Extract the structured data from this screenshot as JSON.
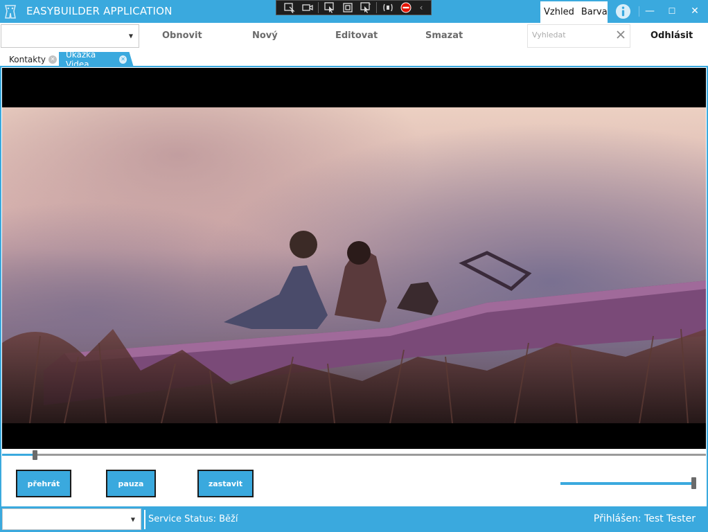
{
  "window": {
    "title": "EASYBUILDER APPLICATION",
    "theme_menu": [
      "Vzhled",
      "Barva"
    ],
    "controls": {
      "minimize": "—",
      "maximize": "☐",
      "close": "✕"
    }
  },
  "debug_toolbar": {
    "icons": [
      "select-element-icon",
      "display-layout-icon",
      "track-focus-icon",
      "toggle-adorners-icon",
      "hot-reload-icon",
      "live-visual-tree-icon",
      "stop-icon"
    ],
    "collapse": "‹"
  },
  "toolbar": {
    "combo_value": "",
    "refresh_label": "Obnovit",
    "new_label": "Nový",
    "edit_label": "Editovat",
    "delete_label": "Smazat",
    "search_placeholder": "Vyhledat",
    "logout_label": "Odhlásit"
  },
  "tabs": [
    {
      "label": "Kontakty",
      "active": false
    },
    {
      "label": "Ukázka Videa",
      "active": true
    }
  ],
  "player": {
    "progress": 0.046,
    "volume": 0.985,
    "play_label": "přehrát",
    "pause_label": "pauza",
    "stop_label": "zastavit"
  },
  "statusbar": {
    "combo_value": "",
    "status_label": "Service Status:",
    "status_value": "Běží",
    "login_text": "Přihlášen: Test Tester"
  },
  "colors": {
    "accent": "#3aa9de",
    "button_border": "#1a1a1a"
  }
}
